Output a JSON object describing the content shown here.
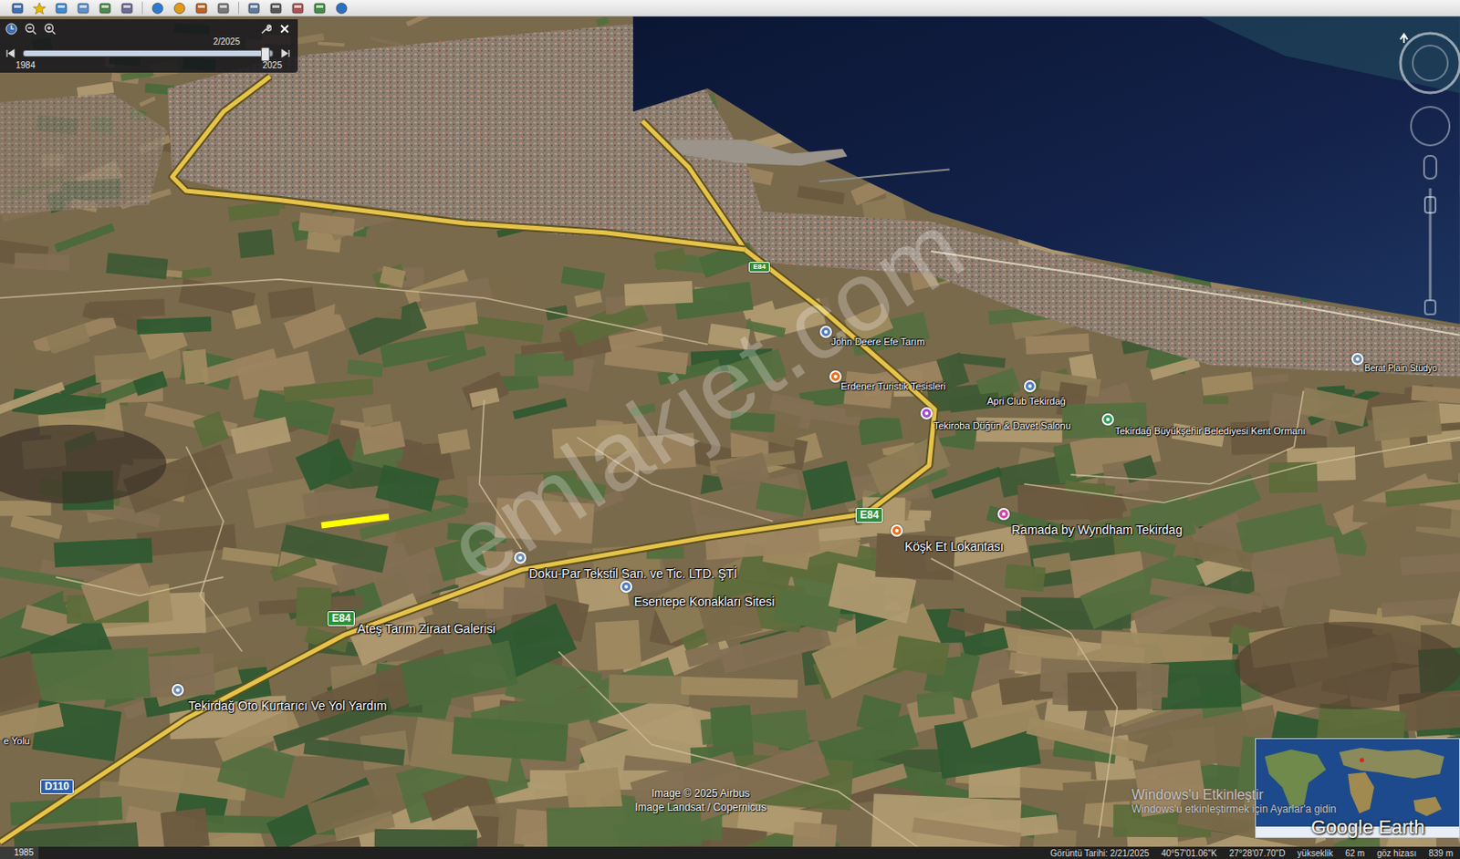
{
  "time_slider": {
    "date": "2/2025",
    "start_year": "1984",
    "end_year": "2025",
    "level": 0.97
  },
  "places": [
    {
      "label": "Doku-Par Tekstil San. ve Tic. LTD. ŞTİ",
      "kind": "pin",
      "color": "#6f8fb5"
    },
    {
      "label": "Esentepe Konakları Sitesi",
      "kind": "pin",
      "color": "#4f7fc0"
    },
    {
      "label": "Ateş Tarım Ziraat Galerisi",
      "kind": "text"
    },
    {
      "label": "Tekirdağ Oto Kurtarıcı Ve Yol Yardım",
      "kind": "pin",
      "color": "#6f8fb5"
    },
    {
      "label": "Köşk Et Lokantası",
      "kind": "pin",
      "color": "#e8711c"
    },
    {
      "label": "Ramada by Wyndham Tekirdag",
      "kind": "pin",
      "color": "#d63fb0"
    },
    {
      "label": "Tekiroba Düğün & Davet Salonu",
      "kind": "pin",
      "color": "#a04ad8"
    },
    {
      "label": "Tekirdağ Büyükşehir Belediyesi Kent Ormanı",
      "kind": "pin",
      "color": "#2f9e5a"
    },
    {
      "label": "Apri Club Tekirdağ",
      "kind": "pin",
      "color": "#4f7fc0"
    },
    {
      "label": "Erdener Turistik Tesisleri",
      "kind": "pin",
      "color": "#e8711c"
    },
    {
      "label": "John Deere Efe Tarım",
      "kind": "pin",
      "color": "#4f7fc0"
    },
    {
      "label": "Berat Plain Stüdyo",
      "kind": "pin",
      "color": "#6f8fb5"
    },
    {
      "label": "e Yolu",
      "kind": "text"
    }
  ],
  "road_shields": [
    {
      "label": "E84",
      "color": "#2f8f3a"
    },
    {
      "label": "E84",
      "color": "#2f8f3a"
    },
    {
      "label": "E84",
      "color": "#2f8f3a"
    },
    {
      "label": "D110",
      "color": "#2b5fb0"
    }
  ],
  "watermark": "emlakjet.com",
  "credits": [
    "Image © 2025 Airbus",
    "Image Landsat / Copernicus"
  ],
  "os_notice": {
    "title": "Windows'u Etkinleştir",
    "text": "Windows'u etkinleştirmek için Ayarlar'a gidin"
  },
  "logo": "Google Earth",
  "status_bar": {
    "year": "1985",
    "date": "Görüntü Tarihi: 2/21/2025",
    "lat": "40°57'01.06\"K",
    "lon": "27°28'07.70\"D",
    "elevation_label": "yükseklik",
    "elevation": "62 m",
    "eye_label": "göz hizası",
    "eye": "839 m"
  }
}
